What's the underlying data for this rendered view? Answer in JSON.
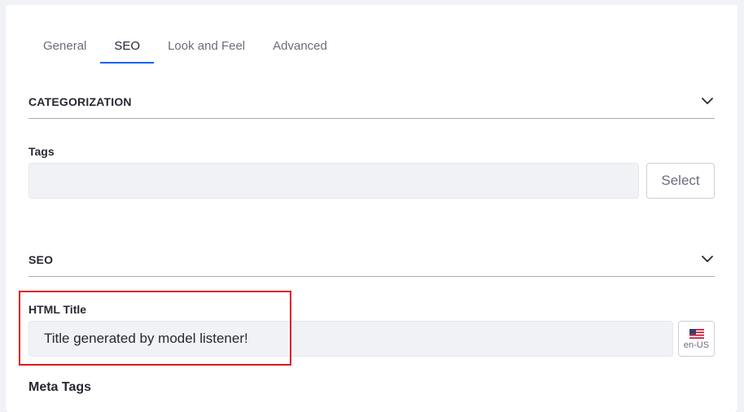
{
  "tabs": [
    {
      "label": "General",
      "active": false
    },
    {
      "label": "SEO",
      "active": true
    },
    {
      "label": "Look and Feel",
      "active": false
    },
    {
      "label": "Advanced",
      "active": false
    }
  ],
  "categorization": {
    "title": "CATEGORIZATION",
    "tags_label": "Tags",
    "tags_value": "",
    "select_label": "Select"
  },
  "seo": {
    "title": "SEO",
    "html_title_label": "HTML Title",
    "html_title_value": "Title generated by model listener!",
    "language_code": "en-US",
    "meta_tags_label": "Meta Tags"
  },
  "colors": {
    "accent": "#0b5fff",
    "highlight": "#e0161e",
    "input_bg": "#f1f2f5"
  },
  "icons": [
    "chevron-down-icon",
    "us-flag-icon"
  ]
}
